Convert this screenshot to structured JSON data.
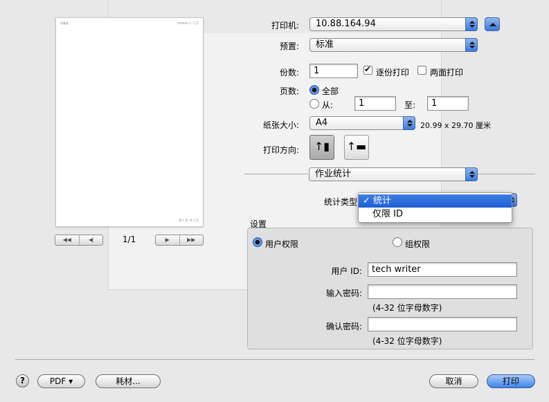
{
  "preview": {
    "header_left": "作業者",
    "header_right": "Untitled 1 / 1 页",
    "footer_right": "第 1 页, 共 1 页",
    "page_indicator": "1/1",
    "nav_first": "◀◀",
    "nav_prev": "◀",
    "nav_next": "▶",
    "nav_last": "▶▶"
  },
  "printer": {
    "label": "打印机:",
    "value": "10.88.164.94"
  },
  "presets": {
    "label": "预置:",
    "value": "标准"
  },
  "copies": {
    "label": "份数:",
    "value": "1",
    "collate_label": "逐份打印",
    "collate_checked": true,
    "duplex_label": "两面打印",
    "duplex_checked": false
  },
  "pages": {
    "label": "页数:",
    "all_label": "全部",
    "from_label": "从:",
    "from_value": "1",
    "to_label": "至:",
    "to_value": "1",
    "selected": "all"
  },
  "paper": {
    "label": "纸张大小:",
    "value": "A4",
    "dimensions": "20.99 x 29.70 厘米"
  },
  "orientation": {
    "label": "打印方向:",
    "portrait_icon": "portrait-icon",
    "landscape_icon": "landscape-icon",
    "selected": "portrait"
  },
  "panel": {
    "value": "作业统计"
  },
  "accounting": {
    "type_label": "统计类型:",
    "menu_options": [
      "统计",
      "仅限 ID"
    ],
    "selected_option": "统计",
    "check_mark": "✓"
  },
  "settings": {
    "title": "设置",
    "user_permission": "用户权限",
    "group_permission": "组权限",
    "selected": "user",
    "user_id_label": "用户 ID:",
    "user_id_value": "tech writer",
    "password_label": "输入密码:",
    "password_hint": "(4-32 位字母数字)",
    "confirm_label": "确认密码:",
    "confirm_hint": "(4-32 位字母数字)"
  },
  "footer": {
    "help": "?",
    "pdf": "PDF ▾",
    "supplies": "耗材...",
    "cancel": "取消",
    "print": "打印"
  },
  "colors": {
    "accent": "#3b7ae0",
    "selection": "#1d5fd4"
  }
}
